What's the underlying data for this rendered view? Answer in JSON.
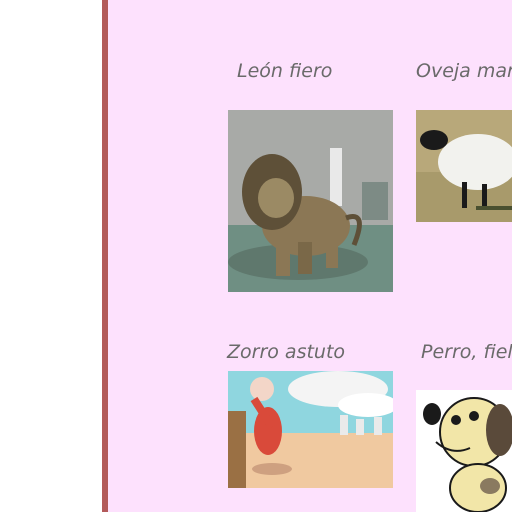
{
  "slide": {
    "captions": {
      "lion": "León fiero",
      "sheep": "Oveja mar",
      "fox": "Zorro astuto",
      "dog": "Perro, fiel"
    }
  },
  "images": {
    "lion": "lion-illustration",
    "sheep": "sheep-illustration",
    "fox": "fox-illustration",
    "dog": "dog-illustration"
  },
  "colors": {
    "slide_background": "#fde1fd",
    "border": "#b35a5a",
    "caption_text": "#6a6a6a"
  }
}
